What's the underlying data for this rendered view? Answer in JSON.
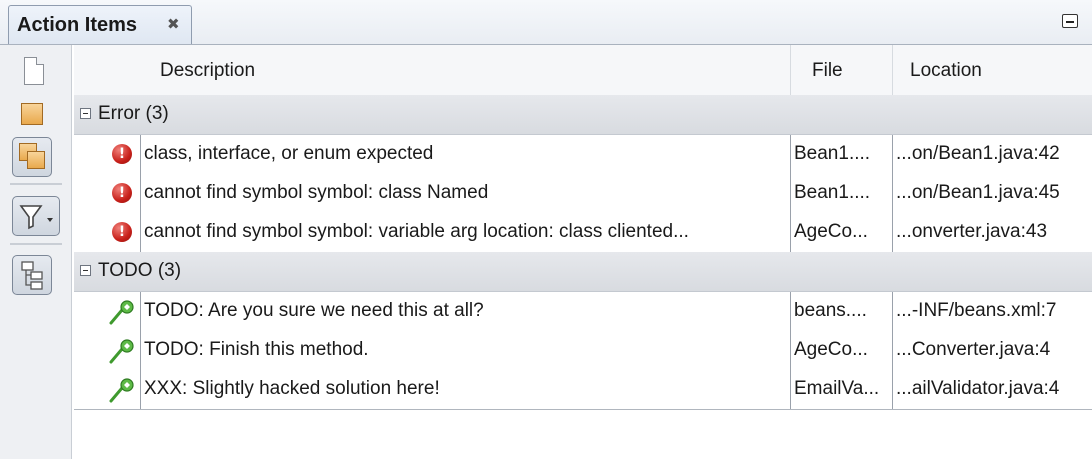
{
  "window": {
    "tab_title": "Action Items",
    "close_glyph": "✖",
    "minimize_icon": "minimize-icon"
  },
  "toolbar": {
    "icons": [
      "file-filter-icon",
      "project-filter-icon",
      "main-project-filter-icon",
      "filter-icon",
      "group-by-icon"
    ]
  },
  "columns": {
    "icon": "",
    "description": "Description",
    "file": "File",
    "location": "Location"
  },
  "groups": [
    {
      "label": "Error (3)",
      "icon": "error-icon",
      "rows": [
        {
          "description": "class, interface, or enum expected",
          "file": "Bean1....",
          "location": "...on/Bean1.java:42"
        },
        {
          "description": "cannot find symbol   symbol: class Named",
          "file": "Bean1....",
          "location": "...on/Bean1.java:45"
        },
        {
          "description": "cannot find symbol   symbol:   variable arg   location: class cliented...",
          "file": "AgeCo...",
          "location": "...onverter.java:43"
        }
      ]
    },
    {
      "label": "TODO (3)",
      "icon": "todo-icon",
      "rows": [
        {
          "description": "TODO: Are you sure we need this at all?",
          "file": "beans....",
          "location": "...-INF/beans.xml:7"
        },
        {
          "description": "TODO: Finish this method.",
          "file": "AgeCo...",
          "location": "...Converter.java:4"
        },
        {
          "description": "XXX: Slightly hacked solution here!",
          "file": "EmailVa...",
          "location": "...ailValidator.java:4"
        }
      ]
    }
  ],
  "colors": {
    "accent_error": "#c8201a",
    "accent_todo": "#3f9a2e",
    "group_bg": "#dcdfe4"
  }
}
